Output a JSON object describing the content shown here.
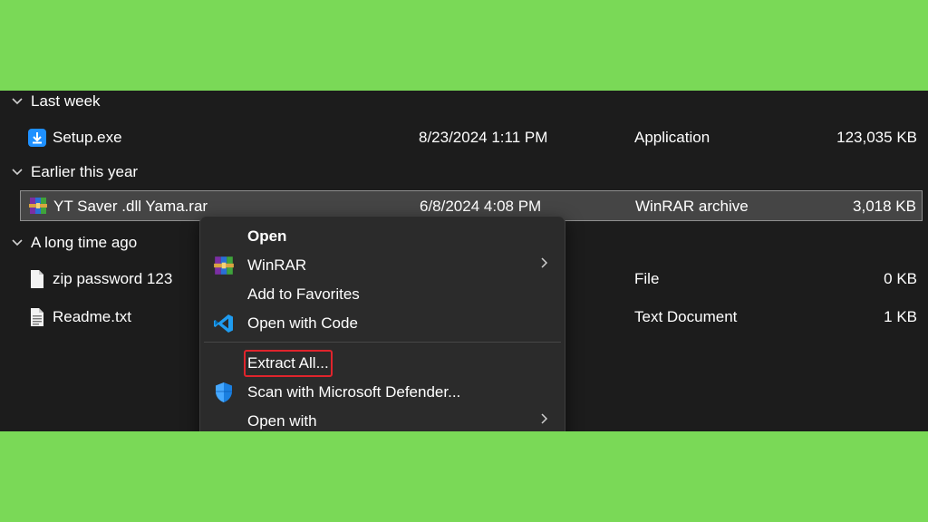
{
  "groups": [
    {
      "label": "Last week"
    },
    {
      "label": "Earlier this year"
    },
    {
      "label": "A long time ago"
    }
  ],
  "files": [
    {
      "name": "Setup.exe",
      "date": "8/23/2024 1:11 PM",
      "type": "Application",
      "size": "123,035 KB",
      "icon": "installer-icon"
    },
    {
      "name": "YT Saver .dll Yama.rar",
      "date": "6/8/2024 4:08 PM",
      "type": "WinRAR archive",
      "size": "3,018 KB",
      "icon": "winrar-archive-icon",
      "selected": true
    },
    {
      "name": "zip password 123",
      "date": "",
      "type": "File",
      "size": "0 KB",
      "icon": "file-icon"
    },
    {
      "name": "Readme.txt",
      "date": "",
      "type": "Text Document",
      "size": "1 KB",
      "icon": "text-document-icon"
    }
  ],
  "context_menu": {
    "items": [
      {
        "label": "Open",
        "bold": true
      },
      {
        "label": "WinRAR",
        "icon": "winrar-icon",
        "submenu": true
      },
      {
        "label": "Add to Favorites"
      },
      {
        "label": "Open with Code",
        "icon": "vscode-icon"
      },
      {
        "label": "Extract All...",
        "highlighted": true
      },
      {
        "label": "Scan with Microsoft Defender...",
        "icon": "defender-shield-icon"
      },
      {
        "label": "Open with",
        "submenu": true
      }
    ]
  },
  "colors": {
    "background_green": "#7ad957",
    "explorer_bg": "#1c1c1c",
    "menu_bg": "#2b2b2b",
    "highlight_red": "#e0242c",
    "selection_bg": "#454545"
  }
}
